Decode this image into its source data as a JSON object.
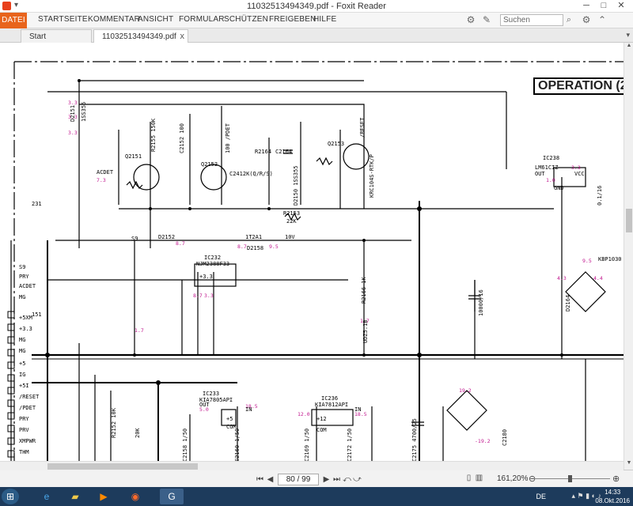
{
  "window": {
    "title": "11032513494349.pdf - Foxit Reader",
    "quick_access": "▾",
    "controls": {
      "minimize": "─",
      "maximize": "□",
      "close": "✕"
    }
  },
  "ribbon": {
    "tabs": [
      "DATEI",
      "STARTSEITE",
      "KOMMENTAR",
      "ANSICHT",
      "FORMULAR",
      "SCHÜTZEN",
      "FREIGEBEN",
      "HILFE"
    ],
    "search_placeholder": "Suchen"
  },
  "doc_tabs": {
    "start": "Start",
    "active": "11032513494349.pdf",
    "close": "x"
  },
  "document": {
    "heading": "OPERATION (2"
  },
  "status": {
    "page": "80 / 99",
    "zoom": "161,20%"
  },
  "taskbar": {
    "lang": "DE",
    "time": "14:33",
    "date": "08.Okt.2016"
  }
}
